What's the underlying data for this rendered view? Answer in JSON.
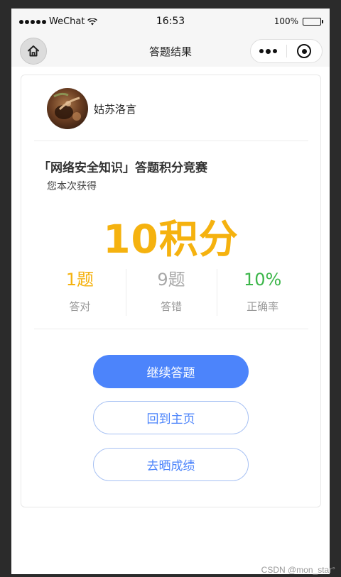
{
  "status_bar": {
    "carrier": "WeChat",
    "time": "16:53",
    "battery": "100%"
  },
  "nav": {
    "title": "答题结果",
    "home_icon": "home-icon",
    "more_icon": "more-dots-icon",
    "close_icon": "close-circle-icon"
  },
  "user": {
    "name": "姑苏洛言"
  },
  "result": {
    "quiz_title": "「网络安全知识」答题积分竞赛",
    "earned_label": "您本次获得",
    "score": "10积分"
  },
  "stats": [
    {
      "value": "1题",
      "label": "答对",
      "color": "#f5b20f"
    },
    {
      "value": "9题",
      "label": "答错",
      "color": "#a8a8a8"
    },
    {
      "value": "10%",
      "label": "正确率",
      "color": "#3cb64a"
    }
  ],
  "buttons": {
    "continue": "继续答题",
    "home": "回到主页",
    "share": "去晒成绩"
  },
  "watermark": "CSDN @mon_star°"
}
